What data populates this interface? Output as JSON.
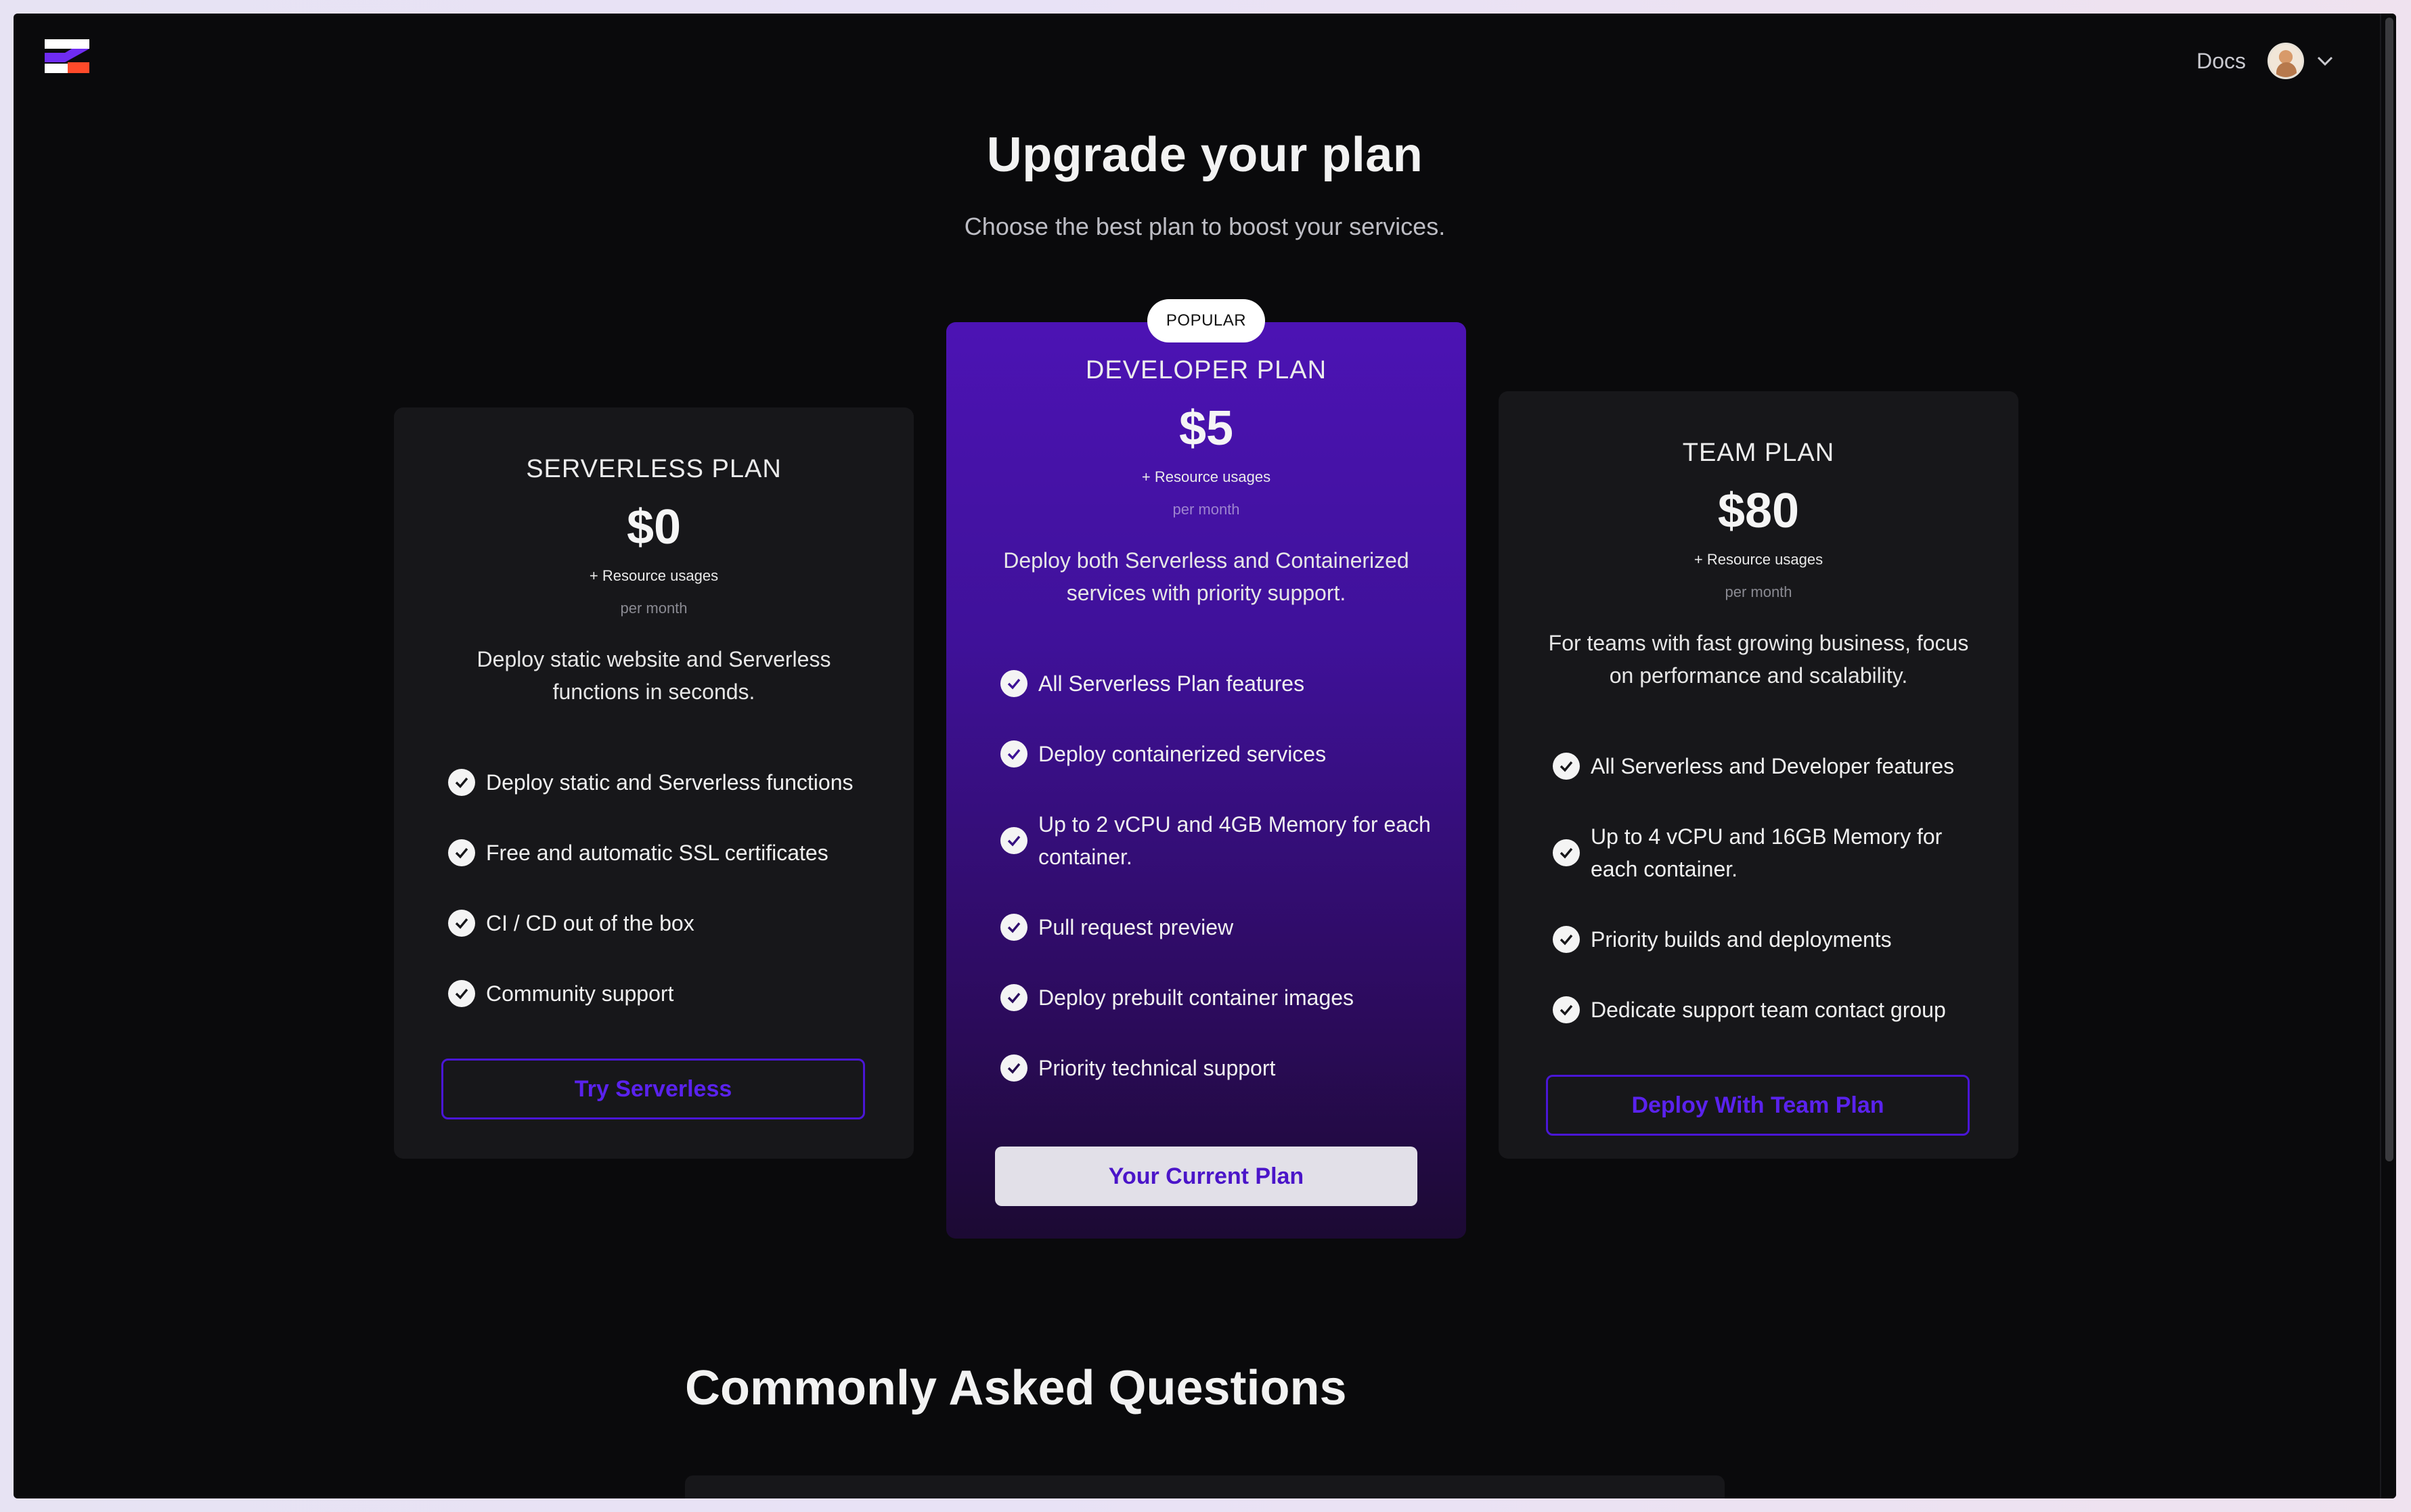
{
  "header": {
    "docs_label": "Docs"
  },
  "hero": {
    "title": "Upgrade your plan",
    "subtitle": "Choose the best plan to boost your services."
  },
  "plans": [
    {
      "name": "SERVERLESS PLAN",
      "price": "$0",
      "resource_note": "+ Resource usages",
      "period": "per month",
      "description": "Deploy static website and Serverless functions in seconds.",
      "features": [
        "Deploy static and Serverless functions",
        "Free and automatic SSL certificates",
        "CI / CD out of the box",
        "Community support"
      ],
      "cta": "Try Serverless"
    },
    {
      "badge": "POPULAR",
      "name": "DEVELOPER PLAN",
      "price": "$5",
      "resource_note": "+ Resource usages",
      "period": "per month",
      "description": "Deploy both Serverless and Containerized services with priority support.",
      "features": [
        "All Serverless Plan features",
        "Deploy containerized services",
        "Up to 2 vCPU and 4GB Memory for each container.",
        "Pull request preview",
        "Deploy prebuilt container images",
        "Priority technical support"
      ],
      "cta": "Your Current Plan"
    },
    {
      "name": "TEAM PLAN",
      "price": "$80",
      "resource_note": "+ Resource usages",
      "period": "per month",
      "description": "For teams with fast growing business, focus on performance and scalability.",
      "features": [
        "All Serverless and Developer features",
        "Up to 4 vCPU and 16GB Memory for each container.",
        "Priority builds and deployments",
        "Dedicate support team contact group"
      ],
      "cta": "Deploy With Team Plan"
    }
  ],
  "faq": {
    "title": "Commonly Asked Questions"
  },
  "colors": {
    "accent": "#4c13b4",
    "button_text": "#5a22ee",
    "background": "#0a0a0c"
  }
}
